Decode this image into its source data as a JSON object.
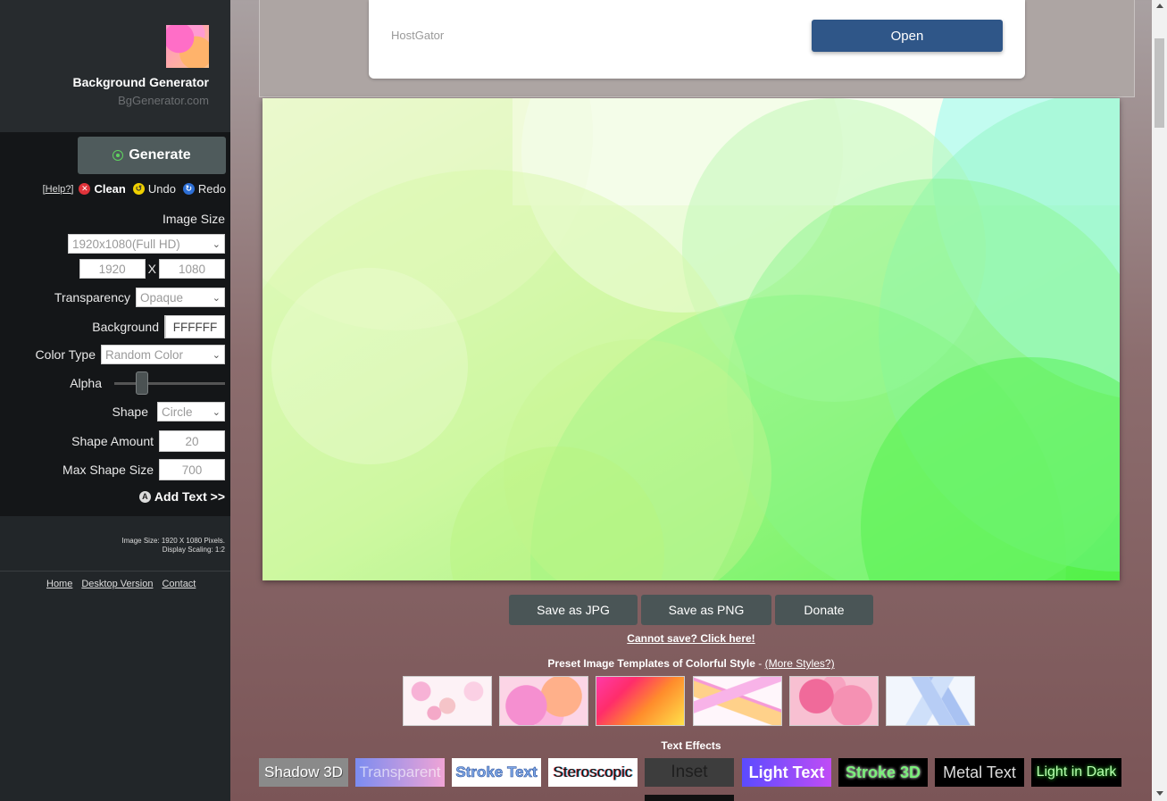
{
  "sidebar": {
    "brand_title": "Background Generator",
    "brand_subtitle": "BgGenerator.com",
    "generate_label": "Generate",
    "help_label": "[Help?]",
    "clean_label": "Clean",
    "undo_label": "Undo",
    "redo_label": "Redo",
    "image_size_label": "Image Size",
    "image_size_value": "1920x1080(Full HD)",
    "width_value": "1920",
    "times_label": "X",
    "height_value": "1080",
    "transparency_label": "Transparency",
    "transparency_value": "Opaque",
    "background_label": "Background",
    "background_value": "FFFFFF",
    "color_type_label": "Color Type",
    "color_type_value": "Random Color",
    "alpha_label": "Alpha",
    "alpha_level": 0.22,
    "shape_label": "Shape",
    "shape_value": "Circle",
    "shape_amount_label": "Shape Amount",
    "shape_amount_value": "20",
    "max_shape_size_label": "Max Shape Size",
    "max_shape_size_value": "700",
    "add_text_label": "Add Text >>",
    "info_line1": "Image Size: 1920 X 1080 Pixels.",
    "info_line2": "Display Scaling: 1:2",
    "footer_links": [
      "Home",
      "Desktop Version",
      "Contact"
    ]
  },
  "ad": {
    "brand": "HostGator",
    "open_label": "Open"
  },
  "actions": {
    "save_jpg": "Save as JPG",
    "save_png": "Save as PNG",
    "donate": "Donate",
    "cannot_save": "Cannot save? Click here!"
  },
  "presets": {
    "heading_bold": "Preset Image Templates of Colorful Style",
    "heading_sep": " - ",
    "more_styles": "(More Styles?)"
  },
  "effects": {
    "heading": "Text Effects",
    "items": [
      "Shadow 3D",
      "Transparent",
      "Stroke Text",
      "Steroscopic",
      "Inset",
      "Light Text",
      "Stroke 3D",
      "Metal Text",
      "Light in Dark"
    ]
  },
  "colors": {
    "sidebar_bg": "#141618",
    "button_bg": "#4a5556",
    "ad_button": "#2f5688"
  }
}
